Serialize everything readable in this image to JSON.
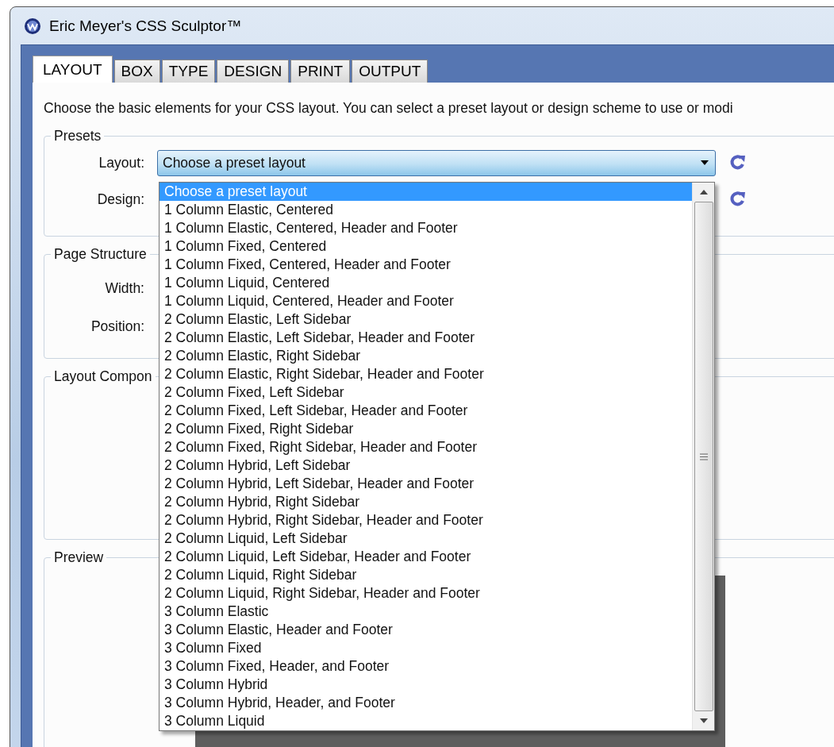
{
  "window": {
    "title": "Eric Meyer's CSS Sculptor™"
  },
  "tabs": [
    {
      "label": "LAYOUT",
      "selected": true
    },
    {
      "label": "BOX",
      "selected": false
    },
    {
      "label": "TYPE",
      "selected": false
    },
    {
      "label": "DESIGN",
      "selected": false
    },
    {
      "label": "PRINT",
      "selected": false
    },
    {
      "label": "OUTPUT",
      "selected": false
    }
  ],
  "intro": "Choose the basic elements for your CSS layout. You can select a preset layout or design scheme to use or modi",
  "presets": {
    "title": "Presets",
    "layout_label": "Layout:",
    "layout_value": "Choose a preset layout",
    "design_label": "Design:",
    "expanded": true,
    "options": [
      {
        "label": "Choose a preset layout",
        "selected": true
      },
      {
        "label": "1 Column Elastic, Centered",
        "selected": false
      },
      {
        "label": "1 Column Elastic, Centered, Header and Footer",
        "selected": false
      },
      {
        "label": "1 Column Fixed, Centered",
        "selected": false
      },
      {
        "label": "1 Column Fixed, Centered, Header and Footer",
        "selected": false
      },
      {
        "label": "1 Column Liquid, Centered",
        "selected": false
      },
      {
        "label": "1 Column Liquid, Centered, Header and Footer",
        "selected": false
      },
      {
        "label": "2 Column Elastic, Left Sidebar",
        "selected": false
      },
      {
        "label": "2 Column Elastic, Left Sidebar, Header and Footer",
        "selected": false
      },
      {
        "label": "2 Column Elastic, Right Sidebar",
        "selected": false
      },
      {
        "label": "2 Column Elastic, Right Sidebar, Header and Footer",
        "selected": false
      },
      {
        "label": "2 Column Fixed, Left Sidebar",
        "selected": false
      },
      {
        "label": "2 Column Fixed, Left Sidebar, Header and Footer",
        "selected": false
      },
      {
        "label": "2 Column Fixed, Right Sidebar",
        "selected": false
      },
      {
        "label": "2 Column Fixed, Right Sidebar, Header and Footer",
        "selected": false
      },
      {
        "label": "2 Column Hybrid, Left Sidebar",
        "selected": false
      },
      {
        "label": "2 Column Hybrid, Left Sidebar, Header and Footer",
        "selected": false
      },
      {
        "label": "2 Column Hybrid, Right Sidebar",
        "selected": false
      },
      {
        "label": "2 Column Hybrid, Right Sidebar, Header and Footer",
        "selected": false
      },
      {
        "label": "2 Column Liquid, Left Sidebar",
        "selected": false
      },
      {
        "label": "2 Column Liquid, Left Sidebar, Header and Footer",
        "selected": false
      },
      {
        "label": "2 Column Liquid, Right Sidebar",
        "selected": false
      },
      {
        "label": "2 Column Liquid, Right Sidebar, Header and Footer",
        "selected": false
      },
      {
        "label": "3 Column Elastic",
        "selected": false
      },
      {
        "label": "3 Column Elastic, Header and Footer",
        "selected": false
      },
      {
        "label": "3 Column Fixed",
        "selected": false
      },
      {
        "label": "3 Column Fixed, Header, and Footer",
        "selected": false
      },
      {
        "label": "3 Column Hybrid",
        "selected": false
      },
      {
        "label": "3 Column Hybrid, Header, and Footer",
        "selected": false
      },
      {
        "label": "3 Column Liquid",
        "selected": false
      }
    ]
  },
  "page_structure": {
    "title": "Page Structure",
    "width_label": "Width:",
    "position_label": "Position:"
  },
  "layout_components": {
    "title": "Layout Compon"
  },
  "preview": {
    "title": "Preview"
  }
}
